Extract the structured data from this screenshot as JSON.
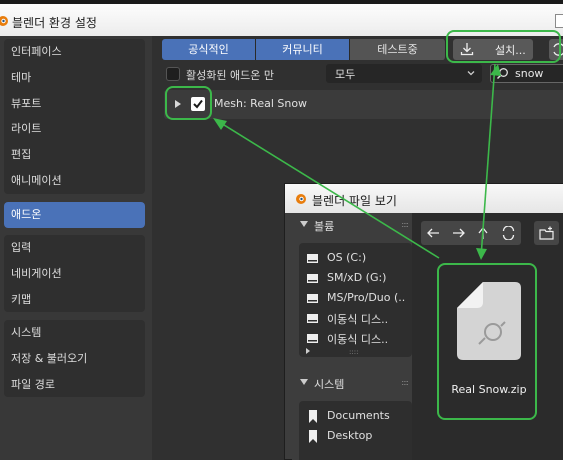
{
  "window": {
    "title": "블렌더 환경 설정"
  },
  "sidebar": {
    "groups": [
      {
        "items": [
          {
            "label": "인터페이스",
            "active": false
          },
          {
            "label": "테마",
            "active": false
          },
          {
            "label": "뷰포트",
            "active": false
          },
          {
            "label": "라이트",
            "active": false
          },
          {
            "label": "편집",
            "active": false
          },
          {
            "label": "애니메이션",
            "active": false
          }
        ]
      },
      {
        "items": [
          {
            "label": "애드온",
            "active": true
          }
        ]
      },
      {
        "items": [
          {
            "label": "입력",
            "active": false
          },
          {
            "label": "네비게이션",
            "active": false
          },
          {
            "label": "키맵",
            "active": false
          }
        ]
      },
      {
        "items": [
          {
            "label": "시스템",
            "active": false
          },
          {
            "label": "저장 & 불러오기",
            "active": false
          },
          {
            "label": "파일 경로",
            "active": false
          }
        ]
      }
    ]
  },
  "addons": {
    "tabs": [
      {
        "label": "공식적인",
        "active": true
      },
      {
        "label": "커뮤니티",
        "active": true
      },
      {
        "label": "테스트중",
        "active": false
      }
    ],
    "install_label": "설치...",
    "enabled_only_label": "활성화된 애드온 만",
    "category_value": "모두",
    "search_value": "snow",
    "list": [
      {
        "name": "Mesh: Real Snow",
        "enabled": true
      }
    ]
  },
  "file_browser": {
    "title": "블렌더 파일 보기",
    "volumes_label": "볼륨",
    "volumes": [
      "OS (C:)",
      "SM/xD (G:)",
      "MS/Pro/Duo (..",
      "이동식 디스..",
      "이동식 디스.."
    ],
    "system_label": "시스템",
    "system_items": [
      "Documents",
      "Desktop"
    ],
    "selected_file": "Real Snow.zip"
  },
  "colors": {
    "accent": "#4a72b8",
    "highlight": "#3cb84a",
    "panel": "#303030",
    "sidebar": "#383838"
  }
}
